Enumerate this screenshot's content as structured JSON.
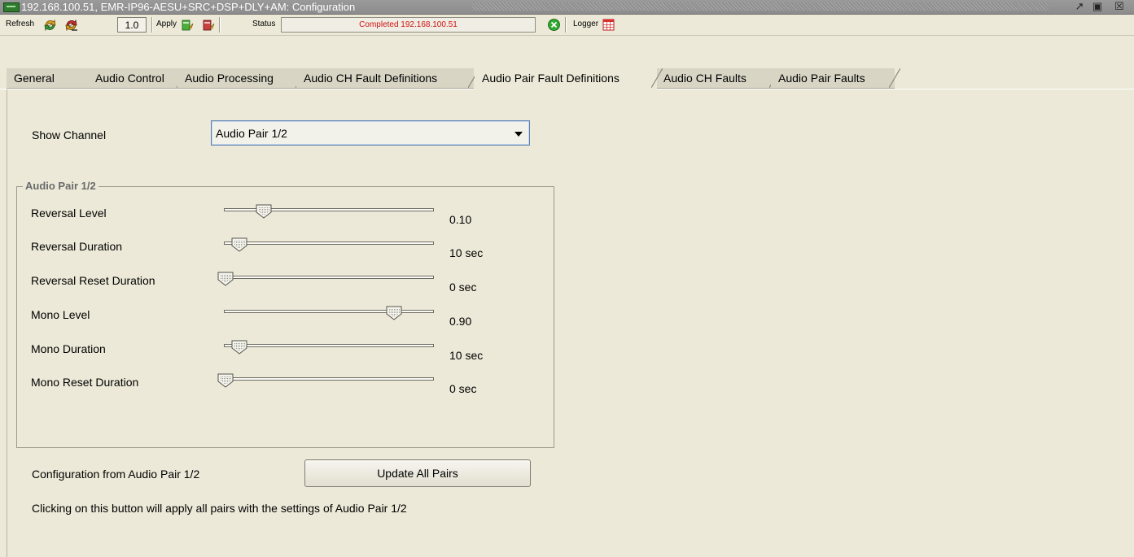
{
  "window": {
    "title": "192.168.100.51, EMR-IP96-AESU+SRC+DSP+DLY+AM: Configuration",
    "icons": [
      "device-icon",
      "undock-icon",
      "maximize-icon",
      "close-icon"
    ]
  },
  "toolbar": {
    "refresh_label": "Refresh",
    "refresh_icons": [
      "refresh-icon",
      "refresh-stop-icon"
    ],
    "version": "1.0",
    "apply_label": "Apply",
    "apply_icons": [
      "apply-icon",
      "apply-cancel-icon"
    ],
    "status_label": "Status",
    "status_text": "Completed 192.168.100.51",
    "status_color": "#d01010",
    "status_icon": "status-x-icon",
    "logger_label": "Logger",
    "logger_icon": "logger-table-icon"
  },
  "tabs": [
    {
      "label": "General",
      "active": false
    },
    {
      "label": "Audio Control",
      "active": false
    },
    {
      "label": "Audio Processing",
      "active": false
    },
    {
      "label": "Audio CH Fault Definitions",
      "active": false
    },
    {
      "label": "Audio Pair Fault Definitions",
      "active": true
    },
    {
      "label": "Audio CH Faults",
      "active": false
    },
    {
      "label": "Audio Pair Faults",
      "active": false
    }
  ],
  "show_channel": {
    "label": "Show Channel",
    "selected": "Audio Pair 1/2"
  },
  "group": {
    "title": "Audio Pair 1/2",
    "rows": [
      {
        "label": "Reversal Level",
        "value": "0.10",
        "position": 0.19
      },
      {
        "label": "Reversal Duration",
        "value": "10 sec",
        "position": 0.07
      },
      {
        "label": "Reversal Reset Duration",
        "value": "0 sec",
        "position": 0.0
      },
      {
        "label": "Mono Level",
        "value": "0.90",
        "position": 0.84
      },
      {
        "label": "Mono Duration",
        "value": "10 sec",
        "position": 0.07
      },
      {
        "label": "Mono Reset Duration",
        "value": "0 sec",
        "position": 0.0
      }
    ]
  },
  "footer": {
    "config_label": "Configuration from  Audio Pair 1/2",
    "update_button": "Update All Pairs",
    "hint": "Clicking on this button will apply all pairs with the settings of  Audio Pair 1/2"
  }
}
